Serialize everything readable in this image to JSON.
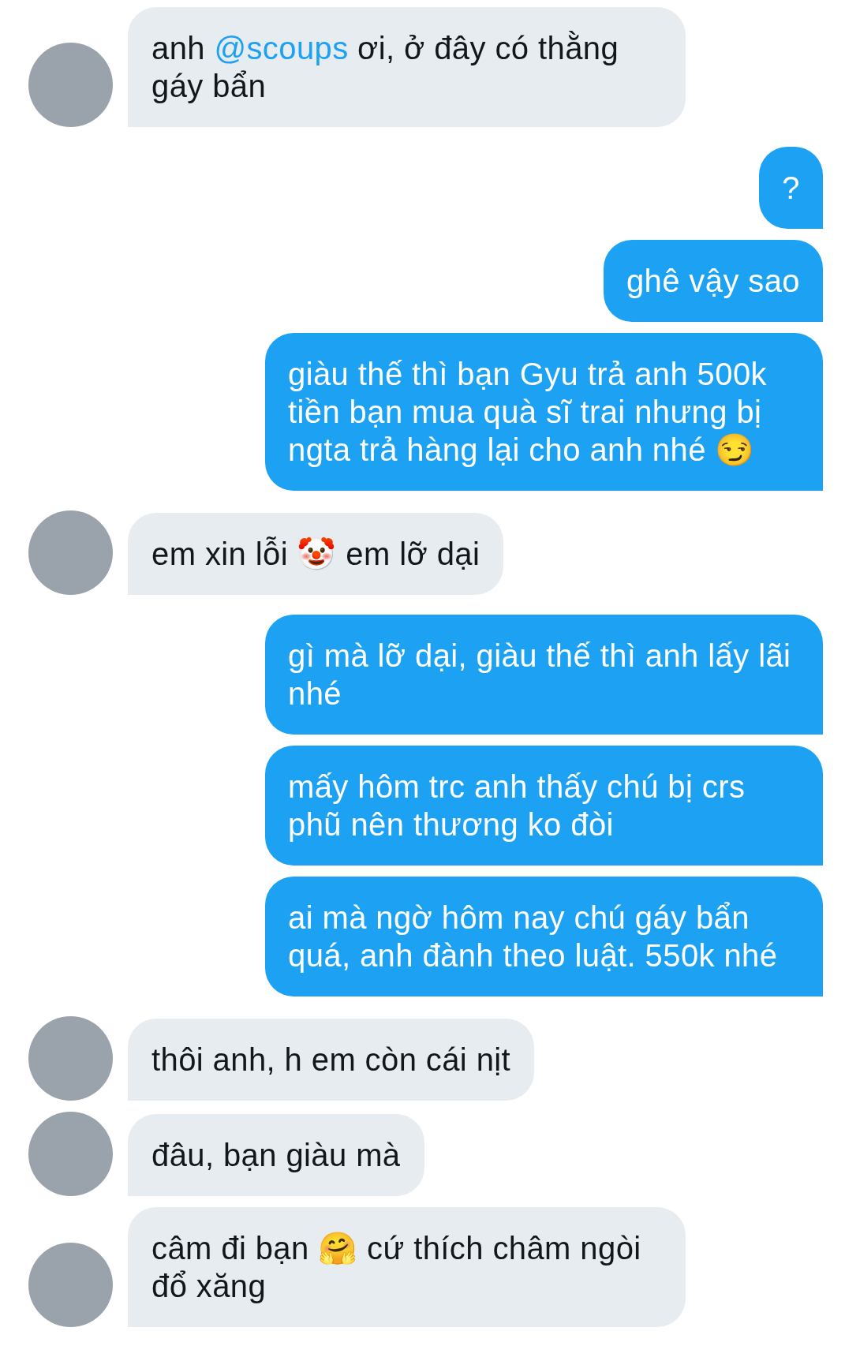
{
  "messages": [
    {
      "kind": "incoming",
      "parts": [
        {
          "kind": "plain",
          "text": "anh "
        },
        {
          "kind": "mention",
          "text": "@scoups"
        },
        {
          "kind": "plain",
          "text": " ơi, ở đây có thằng gáy bẩn"
        }
      ]
    },
    {
      "kind": "outgoing",
      "parts": [
        {
          "kind": "plain",
          "text": "?"
        }
      ]
    },
    {
      "kind": "outgoing",
      "parts": [
        {
          "kind": "plain",
          "text": "ghê vậy sao"
        }
      ]
    },
    {
      "kind": "outgoing",
      "parts": [
        {
          "kind": "plain",
          "text": "giàu thế thì bạn Gyu trả anh 500k tiền bạn mua quà sĩ trai nhưng bị ngta trả hàng lại cho anh nhé 😏"
        }
      ]
    },
    {
      "kind": "incoming",
      "parts": [
        {
          "kind": "plain",
          "text": "em xin lỗi 🤡 em lỡ dại"
        }
      ]
    },
    {
      "kind": "outgoing",
      "parts": [
        {
          "kind": "plain",
          "text": "gì mà lỡ dại, giàu thế thì anh lấy lãi nhé"
        }
      ]
    },
    {
      "kind": "outgoing",
      "parts": [
        {
          "kind": "plain",
          "text": "mấy hôm trc anh thấy chú bị crs phũ nên thương ko đòi"
        }
      ]
    },
    {
      "kind": "outgoing",
      "parts": [
        {
          "kind": "plain",
          "text": "ai mà ngờ hôm nay chú gáy bẩn quá, anh đành theo luật. 550k nhé"
        }
      ]
    },
    {
      "kind": "incoming",
      "parts": [
        {
          "kind": "plain",
          "text": "thôi anh, h em còn cái nịt"
        }
      ]
    },
    {
      "kind": "incoming",
      "parts": [
        {
          "kind": "plain",
          "text": "đâu, bạn giàu mà"
        }
      ]
    },
    {
      "kind": "incoming",
      "parts": [
        {
          "kind": "plain",
          "text": "câm đi bạn 🤗 cứ thích châm ngòi đổ xăng"
        }
      ]
    }
  ]
}
